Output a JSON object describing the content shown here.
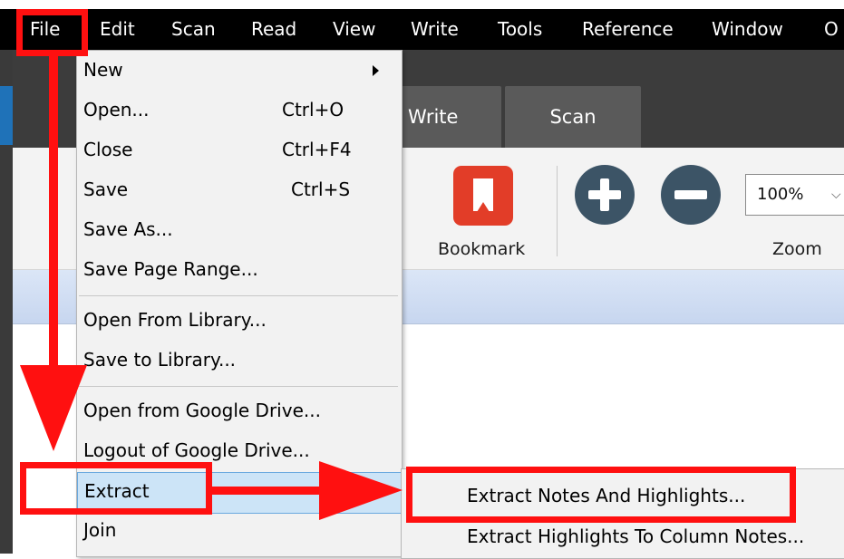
{
  "menubar": {
    "items": [
      "File",
      "Edit",
      "Scan",
      "Read",
      "View",
      "Write",
      "Tools",
      "Reference",
      "Window",
      "O"
    ]
  },
  "tabs": [
    "Write",
    "Scan"
  ],
  "ribbon": {
    "bookmark_label": "Bookmark",
    "zoom_value": "100%",
    "zoom_label": "Zoom"
  },
  "file_menu": {
    "new": {
      "label": "New"
    },
    "open": {
      "label": "Open...",
      "shortcut": "Ctrl+O"
    },
    "close": {
      "label": "Close",
      "shortcut": "Ctrl+F4"
    },
    "save": {
      "label": "Save",
      "shortcut": "Ctrl+S"
    },
    "save_as": {
      "label": "Save As..."
    },
    "save_page_range": {
      "label": "Save Page Range..."
    },
    "open_from_library": {
      "label": "Open From Library..."
    },
    "save_to_library": {
      "label": "Save to Library..."
    },
    "open_google_drive": {
      "label": "Open from Google Drive..."
    },
    "logout_google_drive": {
      "label": "Logout of Google Drive..."
    },
    "extract": {
      "label": "Extract"
    },
    "join": {
      "label": "Join"
    }
  },
  "extract_submenu": {
    "notes_highlights": "Extract Notes And Highlights...",
    "highlights_column": "Extract Highlights To Column Notes..."
  },
  "annotation_color": "#ff1010",
  "colors": {
    "menubar": "#000000",
    "menu_bg": "#f2f2f2",
    "selected": "#cce4f7",
    "bookmark": "#e23d28",
    "zoom_buttons": "#3c5466"
  }
}
